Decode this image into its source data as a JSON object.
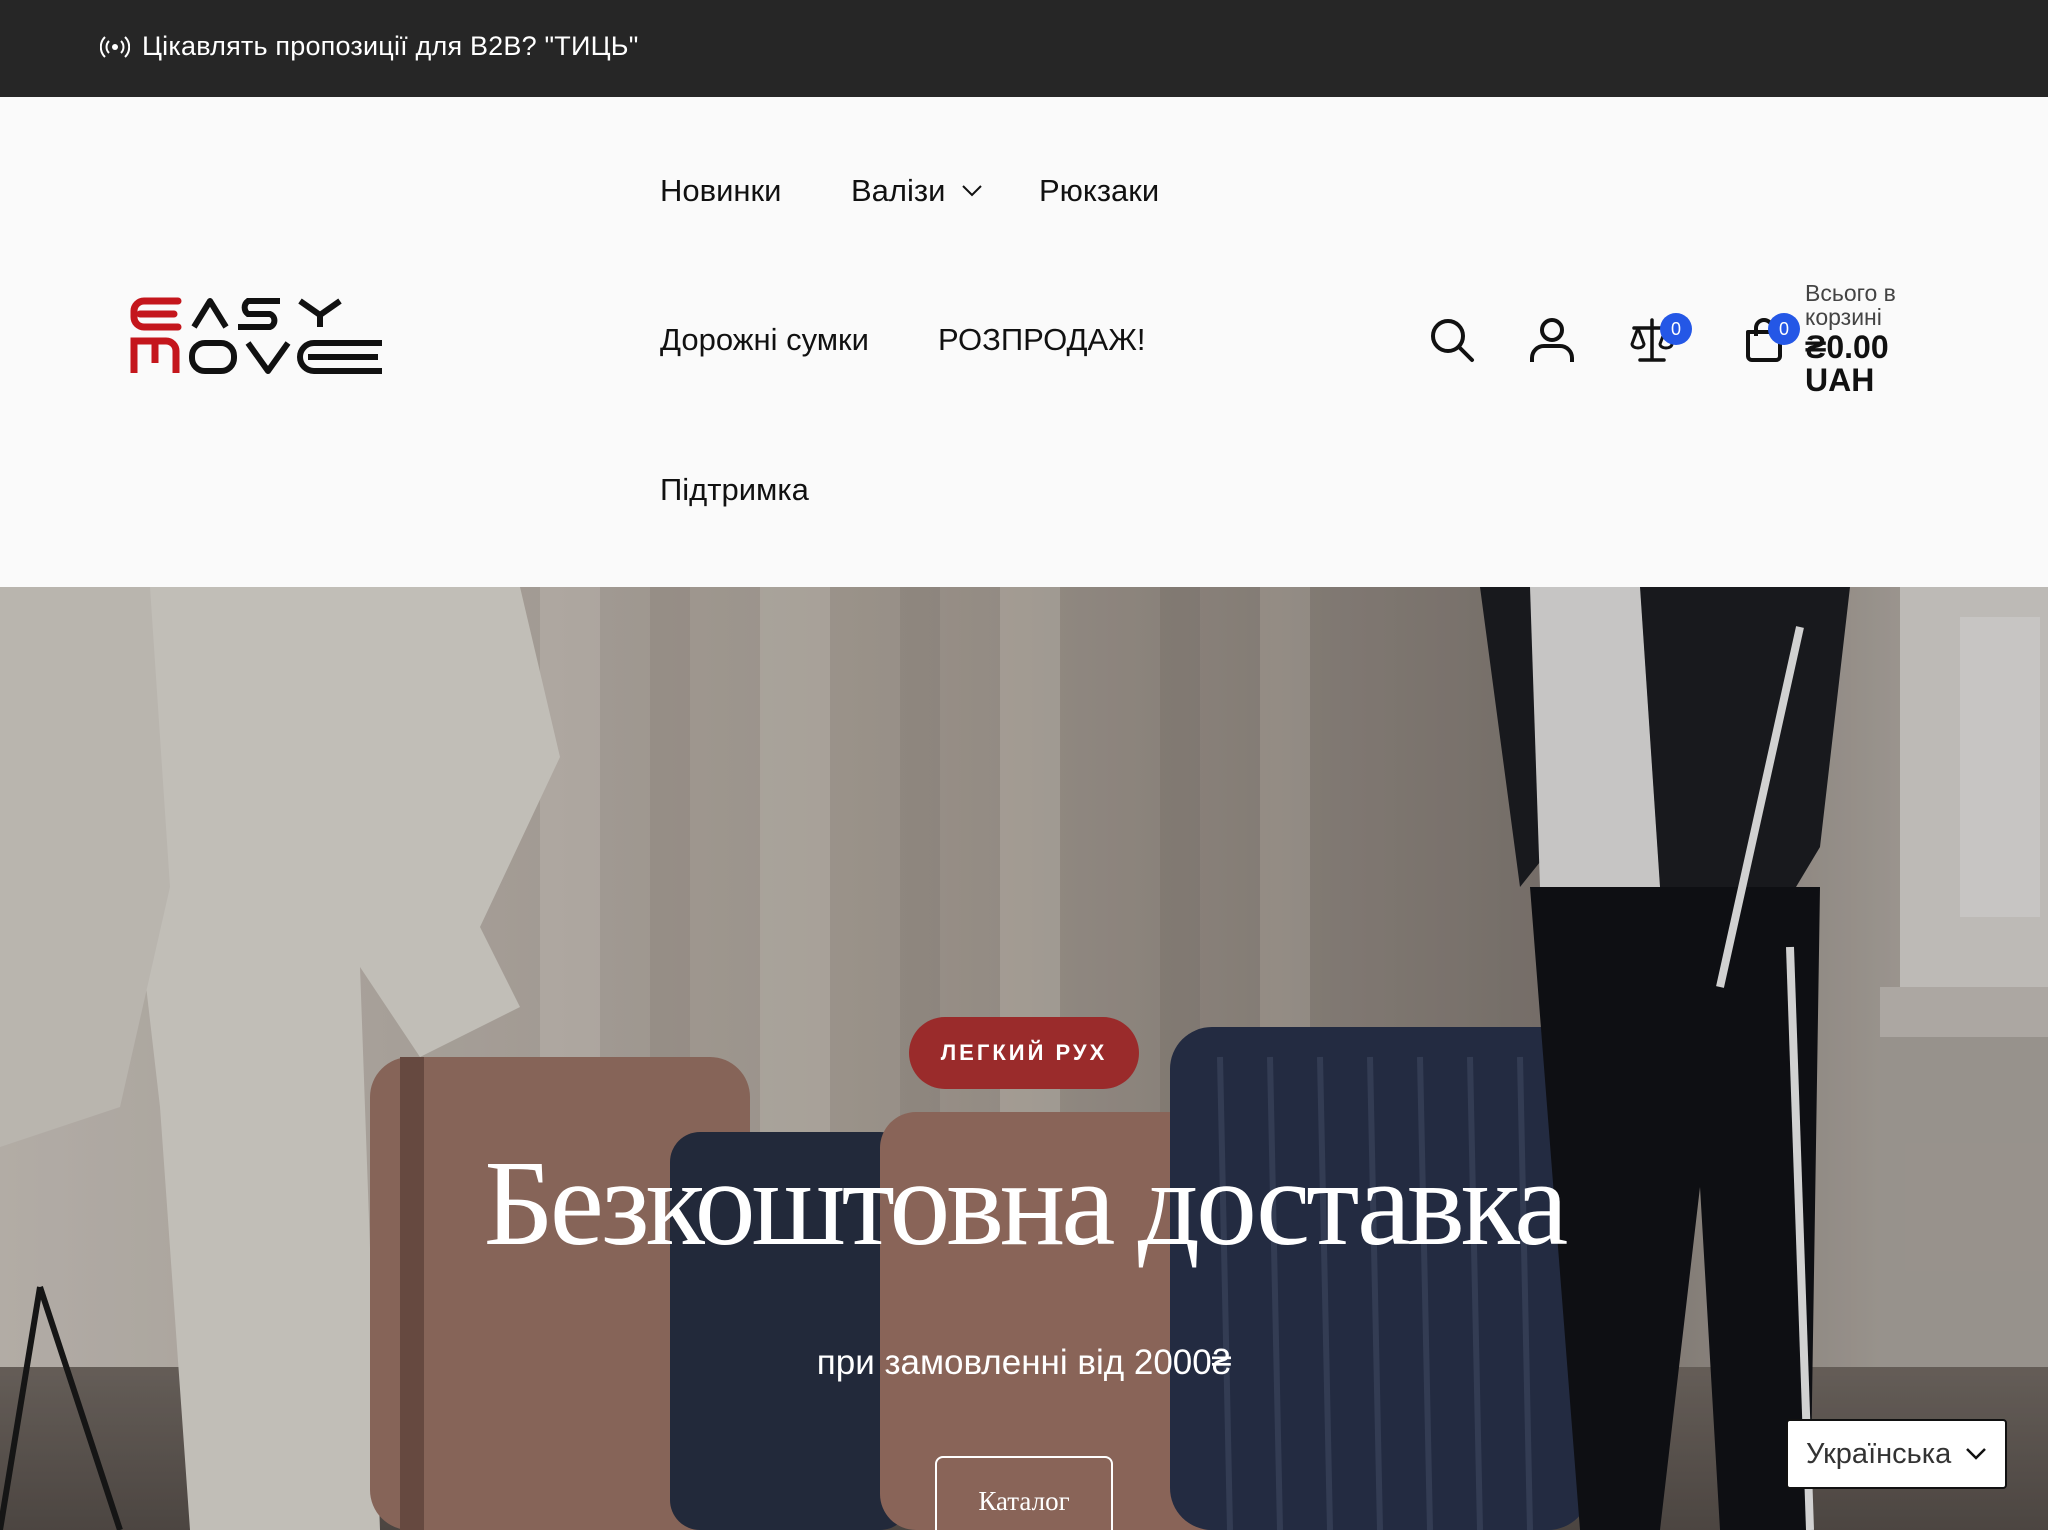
{
  "announcement": {
    "text": "Цікавлять пропозиції для B2B? \"ТИЦЬ\"",
    "icon": "broadcast-icon"
  },
  "logo": {
    "line1": "EASY",
    "line2": "MOVE",
    "accent": "#c4161c"
  },
  "nav": {
    "items": [
      {
        "label": "Новинки"
      },
      {
        "label": "Валізи",
        "has_dropdown": true
      },
      {
        "label": "Рюкзаки"
      },
      {
        "label": "Дорожні сумки"
      },
      {
        "label": "РОЗПРОДАЖ!"
      },
      {
        "label": "Підтримка"
      }
    ]
  },
  "header_icons": {
    "search": "search-icon",
    "account": "user-icon",
    "compare": "scales-icon",
    "compare_count": "0",
    "cart": "bag-icon",
    "cart_count": "0"
  },
  "cart": {
    "label": "Всього в корзині",
    "amount": "₴0.00 UAH"
  },
  "hero": {
    "badge": "ЛЕГКИЙ РУХ",
    "title": "Безкоштовна доставка",
    "subtitle": "при замовленні від 2000₴",
    "button": "Каталог",
    "badge_color": "#9a2b2b"
  },
  "language": {
    "selected": "Українська"
  },
  "colors": {
    "announcement_bg": "#262626",
    "badge_blue": "#2457e6"
  }
}
